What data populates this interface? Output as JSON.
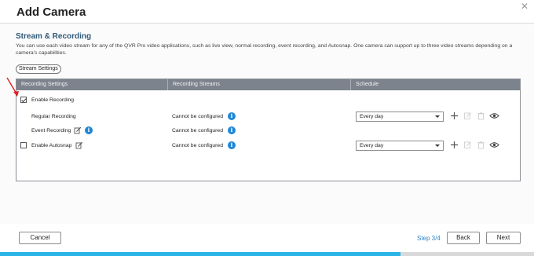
{
  "dialog": {
    "title": "Add Camera"
  },
  "section": {
    "title": "Stream & Recording",
    "description": "You can use each video stream for any of the QVR Pro video applications, such as live view, normal recording, event recording, and Autosnap. One camera can support up to three video streams depending on a camera's capabilities.",
    "stream_settings_label": "Stream Settings"
  },
  "table": {
    "headers": [
      "Recording Settings",
      "Recording Streams",
      "Schedule"
    ],
    "enable_recording": {
      "label": "Enable Recording",
      "checked": true
    },
    "rows": [
      {
        "label": "Regular Recording",
        "stream": "Cannot be configured",
        "schedule": "Every day"
      },
      {
        "label": "Event Recording",
        "stream": "Cannot be configured"
      },
      {
        "label": "Enable Autosnap",
        "stream": "Cannot be configured",
        "schedule": "Every day",
        "checked": false
      }
    ]
  },
  "footer": {
    "cancel_label": "Cancel",
    "step_label": "Step 3/4",
    "back_label": "Back",
    "next_label": "Next"
  },
  "progress": {
    "fraction": 0.75
  },
  "colors": {
    "accent": "#2bb4e6",
    "info": "#1f86d6",
    "header_bg": "#7c838c",
    "annotation": "#e02020"
  },
  "icons": [
    "close-icon",
    "edit-icon",
    "info-icon",
    "chevron-down-icon",
    "add-icon",
    "edit-disabled-icon",
    "delete-icon",
    "view-icon",
    "red-arrow-annotation"
  ]
}
